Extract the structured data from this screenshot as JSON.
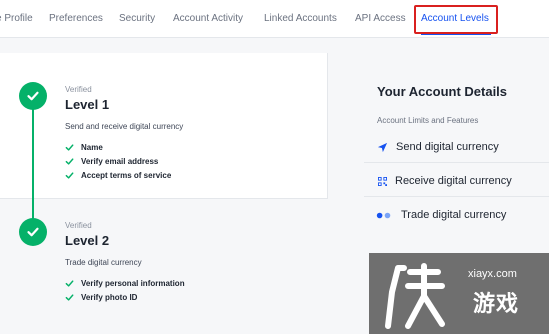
{
  "nav": {
    "tabs": [
      {
        "label": "e Profile"
      },
      {
        "label": "Preferences"
      },
      {
        "label": "Security"
      },
      {
        "label": "Account Activity"
      },
      {
        "label": "Linked Accounts"
      },
      {
        "label": "API Access"
      },
      {
        "label": "Account Levels"
      }
    ],
    "active_tab": "Account Levels"
  },
  "levels": [
    {
      "status": "Verified",
      "title": "Level 1",
      "description": "Send and receive digital currency",
      "requirements": [
        "Name",
        "Verify email address",
        "Accept terms of service"
      ]
    },
    {
      "status": "Verified",
      "title": "Level 2",
      "description": "Trade digital currency",
      "requirements": [
        "Verify personal information",
        "Verify photo ID"
      ]
    }
  ],
  "details": {
    "title": "Your Account Details",
    "subtitle": "Account Limits and Features",
    "items": [
      {
        "label": "Send digital currency",
        "icon": "send-icon"
      },
      {
        "label": "Receive digital currency",
        "icon": "qr-code-icon"
      },
      {
        "label": "Trade digital currency",
        "icon": "trade-icon"
      }
    ]
  },
  "watermark": {
    "url": "xiayx.com",
    "name": "游戏"
  },
  "colors": {
    "accent": "#1652f0",
    "verified": "#05b169",
    "highlight": "#d9201f"
  }
}
